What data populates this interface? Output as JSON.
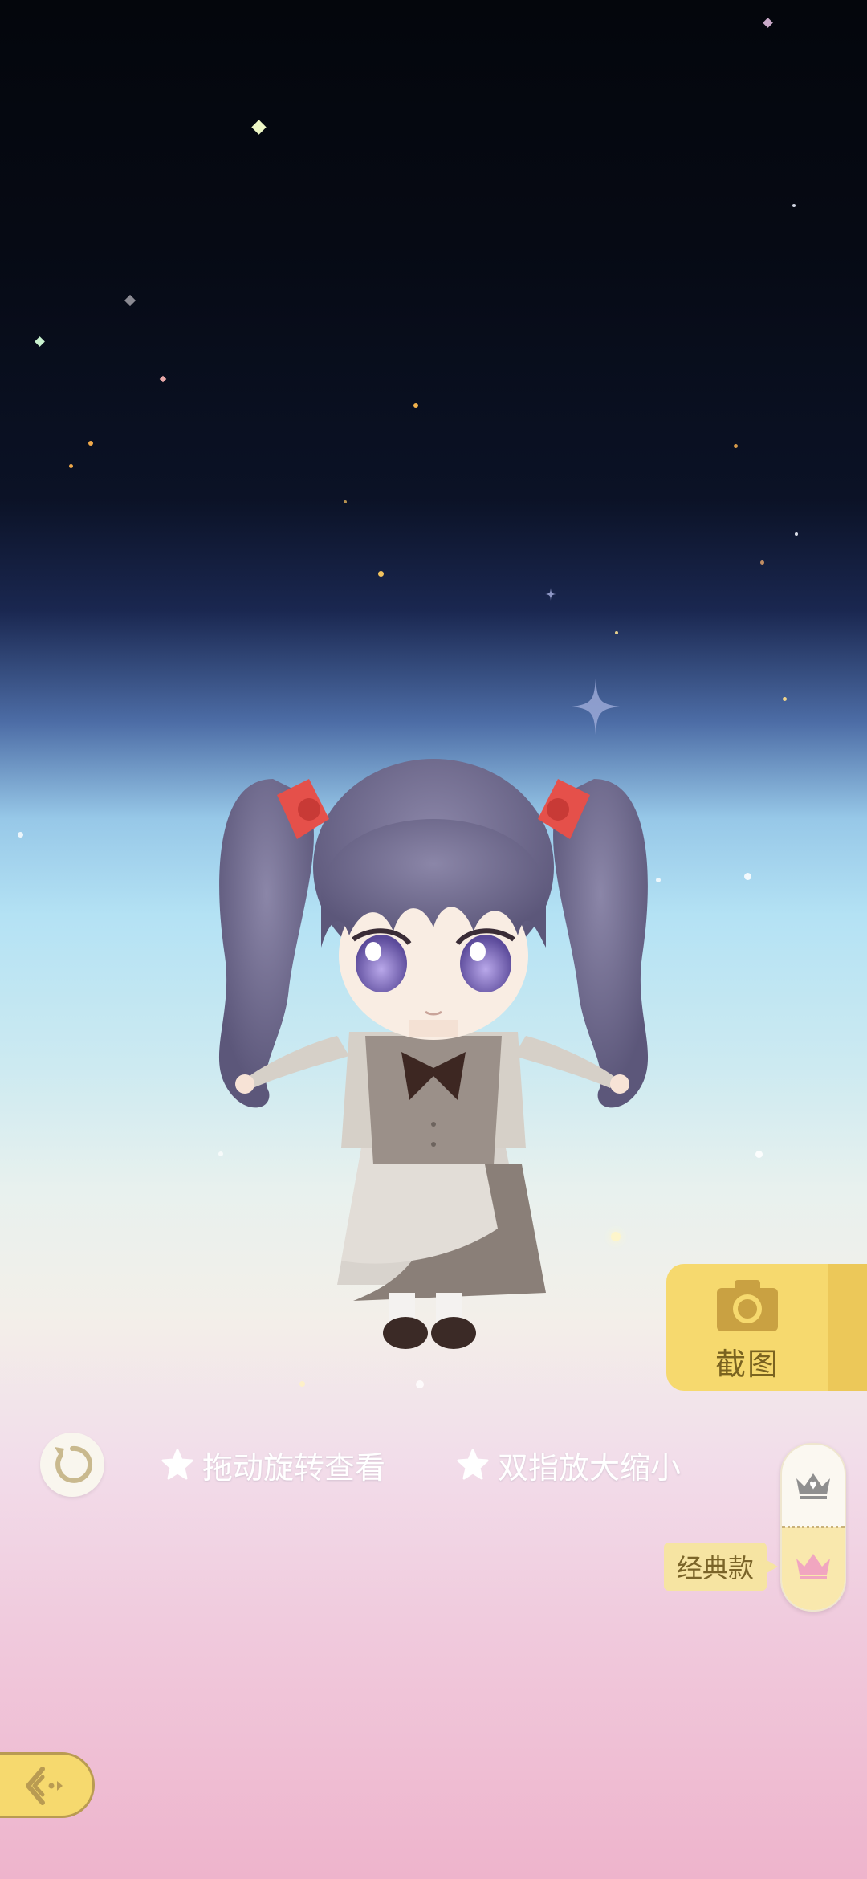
{
  "toolbar": {
    "screenshot_label": "截图"
  },
  "hints": {
    "rotate": "拖动旋转查看",
    "zoom": "双指放大缩小"
  },
  "style_toggle": {
    "selected_label": "经典款"
  },
  "icons": {
    "screenshot": "camera-icon",
    "reset": "refresh-icon",
    "hint_bullet": "star-icon",
    "premium_style": "crown-icon",
    "classic_style": "crown-icon",
    "back": "back-arrow-icon"
  },
  "colors": {
    "accent_yellow": "#f6d96e",
    "accent_text": "#7a6320",
    "sky_top": "#04060c",
    "sky_bottom": "#eeb4cc"
  }
}
